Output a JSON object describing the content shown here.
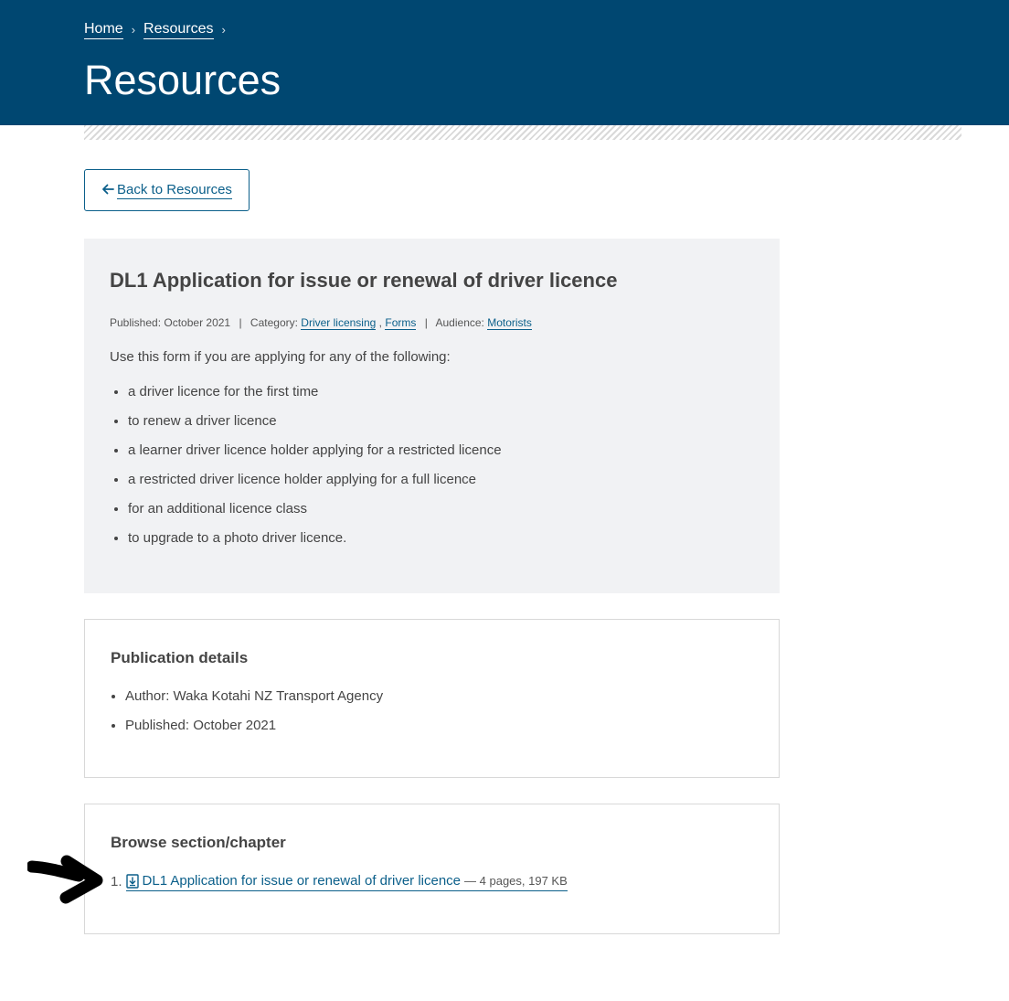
{
  "breadcrumb": {
    "home": "Home",
    "resources": "Resources",
    "separator": "›"
  },
  "hero": {
    "title": "Resources"
  },
  "back_button": {
    "arrow": "🡐",
    "label": "Back to Resources"
  },
  "intro": {
    "title": "DL1 Application for issue or renewal of driver licence",
    "meta": {
      "published_label": "Published:",
      "published_value": "October 2021",
      "category_label": "Category:",
      "category_1": "Driver licensing",
      "category_sep": ",",
      "category_2": "Forms",
      "audience_label": "Audience:",
      "audience_value": "Motorists",
      "pipe": "|"
    },
    "text": "Use this form if you are applying for any of the following:",
    "items": [
      "a driver licence for the first time",
      "to renew a driver licence",
      "a learner driver licence holder applying for a restricted licence",
      "a restricted driver licence holder applying for a full licence",
      "for an additional licence class",
      "to upgrade to a photo driver licence."
    ]
  },
  "publication_details": {
    "title": "Publication details",
    "items": [
      "Author: Waka Kotahi NZ Transport Agency",
      "Published: October 2021"
    ]
  },
  "browse": {
    "title": "Browse section/chapter",
    "chapters": [
      {
        "number": "1.",
        "link": "DL1 Application for issue or renewal of driver licence",
        "info": "— 4 pages, 197 KB",
        "icon": "download-document-icon"
      }
    ]
  },
  "colors": {
    "header_bg": "#004771",
    "link": "#0b5f8a",
    "card_bg": "#f1f2f4",
    "text": "#444444"
  }
}
